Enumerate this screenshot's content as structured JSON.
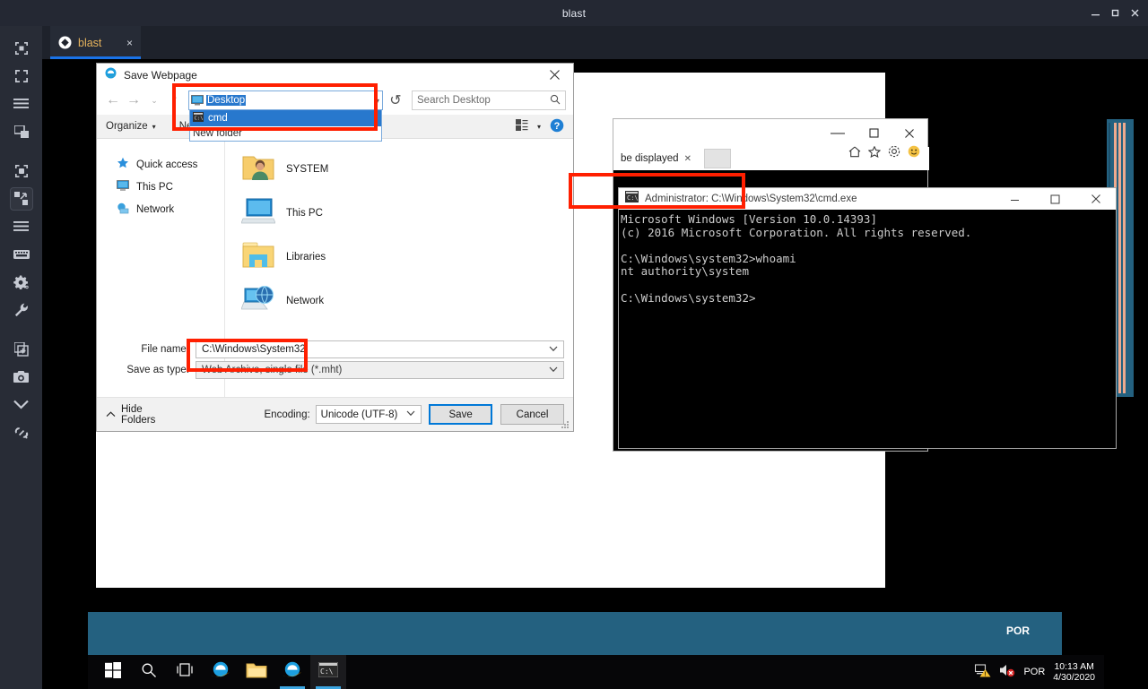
{
  "app": {
    "title": "blast",
    "window_controls": [
      "minimize",
      "maximize",
      "close"
    ]
  },
  "tab": {
    "label": "blast",
    "close_label": "×",
    "icon": "blast-logo-icon"
  },
  "sidebar": {
    "items": [
      {
        "name": "fit-to-window-icon"
      },
      {
        "name": "fullscreen-icon"
      },
      {
        "name": "menu-icon"
      },
      {
        "name": "multi-window-icon"
      },
      {
        "name": "scale-icon"
      },
      {
        "name": "expand-icon",
        "selected": true
      },
      {
        "name": "list-icon"
      },
      {
        "name": "keyboard-icon"
      },
      {
        "name": "settings-gear-icon"
      },
      {
        "name": "wrench-icon"
      },
      {
        "name": "new-window-icon"
      },
      {
        "name": "camera-icon"
      },
      {
        "name": "chevron-down-icon"
      },
      {
        "name": "link-broken-icon"
      }
    ]
  },
  "save_dialog": {
    "title": "Save Webpage",
    "close_label": "✕",
    "nav": {
      "back": "←",
      "forward": "→",
      "recent": "⌄",
      "up": "↑"
    },
    "address": {
      "value": "Desktop",
      "dropdown_arrow": "▾",
      "suggestions": [
        {
          "label": "cmd",
          "icon": "cmd-icon",
          "selected": true
        },
        {
          "label": "New folder",
          "icon": "folder-icon",
          "selected": false
        }
      ]
    },
    "refresh_label": "↺",
    "search": {
      "placeholder": "Search Desktop",
      "icon": "search-icon"
    },
    "toolbar": {
      "organize": "Organize",
      "organize_caret": "▾",
      "new_folder": "New folder",
      "view_caret": "▾",
      "help": "?"
    },
    "tree": [
      {
        "label": "Quick access",
        "icon": "star-icon"
      },
      {
        "label": "This PC",
        "icon": "computer-icon"
      },
      {
        "label": "Network",
        "icon": "network-icon"
      }
    ],
    "items": [
      {
        "label": "SYSTEM",
        "icon": "user-folder-icon"
      },
      {
        "label": "This PC",
        "icon": "computer-icon"
      },
      {
        "label": "Libraries",
        "icon": "libraries-icon"
      },
      {
        "label": "Network",
        "icon": "network-globe-icon"
      }
    ],
    "fields": {
      "file_name_label": "File name:",
      "file_name_value": "C:\\Windows\\System32",
      "save_as_type_label": "Save as type:",
      "save_as_type_value": "Web Archive, single file (*.mht)"
    },
    "footer": {
      "hide_folders": "Hide Folders",
      "hide_caret": "∧",
      "encoding_label": "Encoding:",
      "encoding_value": "Unicode (UTF-8)",
      "save": "Save",
      "cancel": "Cancel"
    }
  },
  "ie_window": {
    "tab_label": "be displayed",
    "tab_close": "✕",
    "new_tab_label": "",
    "controls": {
      "minimize": "—",
      "maximize": "☐",
      "close": "✕"
    },
    "icons": [
      "home-icon",
      "favorites-star-icon",
      "settings-gear-icon",
      "smiley-icon"
    ]
  },
  "cmd_window": {
    "title": "Administrator: C:\\Windows\\System32\\cmd.exe",
    "icon": "cmd-icon",
    "controls": {
      "minimize": "—",
      "maximize": "☐",
      "close": "✕"
    },
    "lines": [
      "Microsoft Windows [Version 10.0.14393]",
      "(c) 2016 Microsoft Corporation. All rights reserved.",
      "",
      "C:\\Windows\\system32>whoami",
      "nt authority\\system",
      "",
      "C:\\Windows\\system32>"
    ]
  },
  "desktop": {
    "banner_text": "POR"
  },
  "taskbar": {
    "buttons": [
      {
        "name": "start-button",
        "icon": "windows-logo-icon"
      },
      {
        "name": "search-button",
        "icon": "search-icon"
      },
      {
        "name": "task-view-button",
        "icon": "task-view-icon"
      },
      {
        "name": "ie-pinned-button",
        "icon": "internet-explorer-icon"
      },
      {
        "name": "file-explorer-button",
        "icon": "folder-icon"
      },
      {
        "name": "ie-running-button",
        "icon": "internet-explorer-icon",
        "running": true
      },
      {
        "name": "cmd-running-button",
        "icon": "cmd-icon",
        "running": true,
        "active": true
      }
    ],
    "tray": {
      "network_icon": "network-warning-icon",
      "volume_icon": "volume-muted-icon",
      "language": "POR",
      "time": "10:13 AM",
      "date": "4/30/2020"
    }
  },
  "annotations": {
    "highlight_color": "#ff1f00",
    "boxes": [
      {
        "name": "address-bar-highlight"
      },
      {
        "name": "file-name-highlight"
      },
      {
        "name": "whoami-output-highlight"
      }
    ]
  }
}
